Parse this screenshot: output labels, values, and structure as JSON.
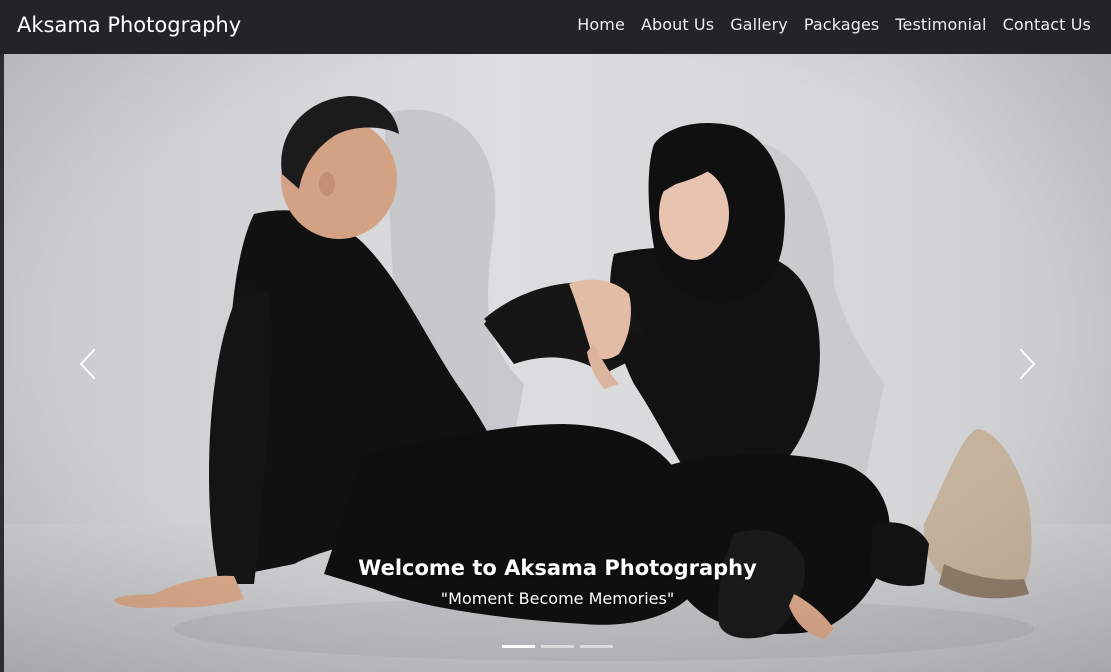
{
  "navbar": {
    "brand": "Aksama Photography",
    "links": [
      {
        "label": "Home"
      },
      {
        "label": "About Us"
      },
      {
        "label": "Gallery"
      },
      {
        "label": "Packages"
      },
      {
        "label": "Testimonial"
      },
      {
        "label": "Contact Us"
      }
    ]
  },
  "carousel": {
    "caption_title": "Welcome to Aksama Photography",
    "caption_text": "\"Moment Become Memories\"",
    "slide_count": 3,
    "active_slide": 1,
    "prev_icon": "chevron-left-icon",
    "next_icon": "chevron-right-icon"
  },
  "colors": {
    "navbar_bg": "#212529",
    "text": "#ffffff",
    "backdrop": "#d6d7d9"
  }
}
